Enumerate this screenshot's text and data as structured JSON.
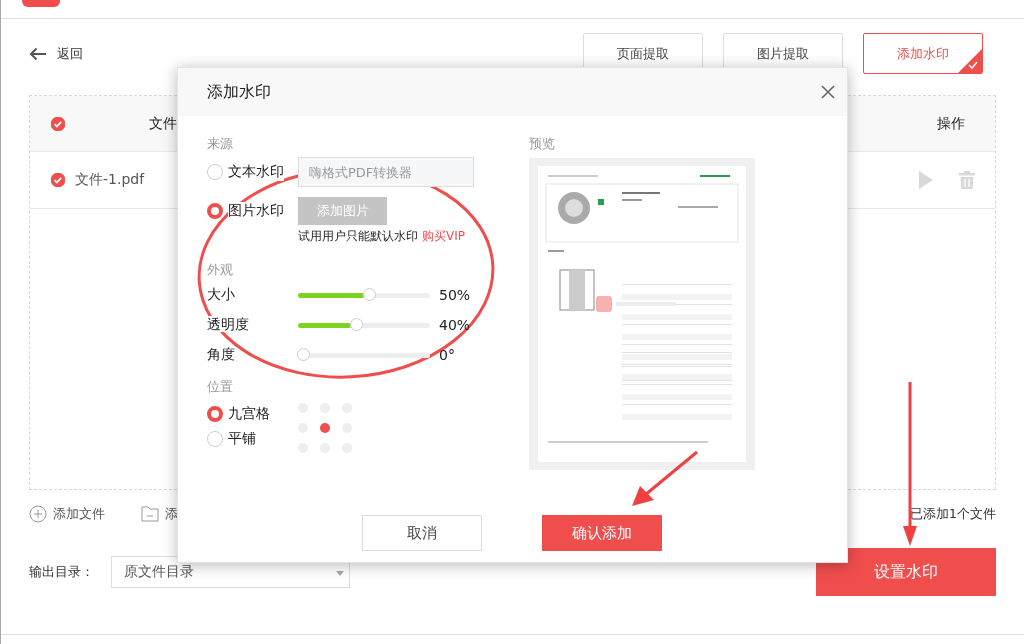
{
  "back": {
    "label": "返回"
  },
  "function_tabs": [
    {
      "label": "页面提取",
      "selected": false
    },
    {
      "label": "图片提取",
      "selected": false
    },
    {
      "label": "添加水印",
      "selected": true
    }
  ],
  "file_table": {
    "columns": [
      "文件",
      "操作"
    ],
    "all_checked": true,
    "rows": [
      {
        "name": "文件-1.pdf",
        "checked": true
      }
    ]
  },
  "add_file": "添加文件",
  "add_folder": "添",
  "file_count": "已添加1个文件",
  "output": {
    "label": "输出目录：",
    "value": "原文件目录"
  },
  "start_button": "设置水印",
  "dialog": {
    "title": "添加水印",
    "source_label": "来源",
    "sources": [
      {
        "label": "文本水印",
        "selected": false
      },
      {
        "label": "图片水印",
        "selected": true
      }
    ],
    "text_field": {
      "placeholder": "嗨格式PDF转换器"
    },
    "add_image_button": {
      "label": "添加图片",
      "disabled": true
    },
    "trial_note": "试用用户只能默认水印",
    "vip_link": "购买VIP",
    "appearance_label": "外观",
    "sliders": [
      {
        "label": "大小",
        "level": 0.5,
        "reading": "50%"
      },
      {
        "label": "透明度",
        "level": 0.4,
        "reading": "40%"
      },
      {
        "label": "角度",
        "level": 0,
        "reading": "0°"
      }
    ],
    "position_label": "位置",
    "position_modes": [
      {
        "label": "九宫格",
        "selected": true
      },
      {
        "label": "平铺",
        "selected": false
      }
    ],
    "grid_cells": [
      {
        "selected": false
      },
      {
        "selected": false
      },
      {
        "selected": false
      },
      {
        "selected": false
      },
      {
        "selected": true
      },
      {
        "selected": false
      },
      {
        "selected": false
      },
      {
        "selected": false
      },
      {
        "selected": false
      }
    ],
    "preview_label": "预览",
    "cancel": "取消",
    "confirm": "确认添加"
  }
}
